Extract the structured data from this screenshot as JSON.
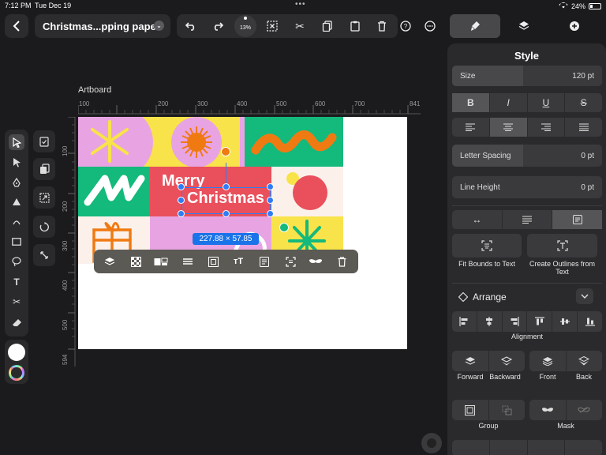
{
  "status": {
    "time": "7:12 PM",
    "date": "Tue Dec 19",
    "battery": "24%"
  },
  "document": {
    "title": "Christmas...pping paper"
  },
  "toolbar": {
    "zoom": "13%"
  },
  "panel": {
    "title": "Style",
    "size_label": "Size",
    "size_value": "120 pt",
    "format_buttons": [
      "B",
      "I",
      "U",
      "S"
    ],
    "letter_spacing_label": "Letter Spacing",
    "letter_spacing_value": "0 pt",
    "line_height_label": "Line Height",
    "line_height_value": "0 pt",
    "fit_bounds_label": "Fit Bounds to Text",
    "create_outlines_label": "Create Outlines from Text",
    "arrange_label": "Arrange",
    "alignment_label": "Alignment",
    "forward_label": "Forward",
    "backward_label": "Backward",
    "front_label": "Front",
    "back_label": "Back",
    "group_label": "Group",
    "mask_label": "Mask"
  },
  "canvas": {
    "artboard_label": "Artboard",
    "ruler_h": [
      "100",
      "200",
      "300",
      "400",
      "500",
      "600",
      "700",
      "841"
    ],
    "ruler_v": [
      "100",
      "200",
      "300",
      "400",
      "500",
      "594"
    ],
    "text_line1": "Merry",
    "text_line2": "Christmas",
    "dimensions": "227.88 × 57.85"
  },
  "colors": {
    "pink": "#e8a4e2",
    "yellow": "#f8e34a",
    "green": "#14b97c",
    "red": "#e9505c",
    "orange": "#f07a12",
    "cream": "#fcf1ea",
    "accent_blue": "#2f7cf6"
  }
}
